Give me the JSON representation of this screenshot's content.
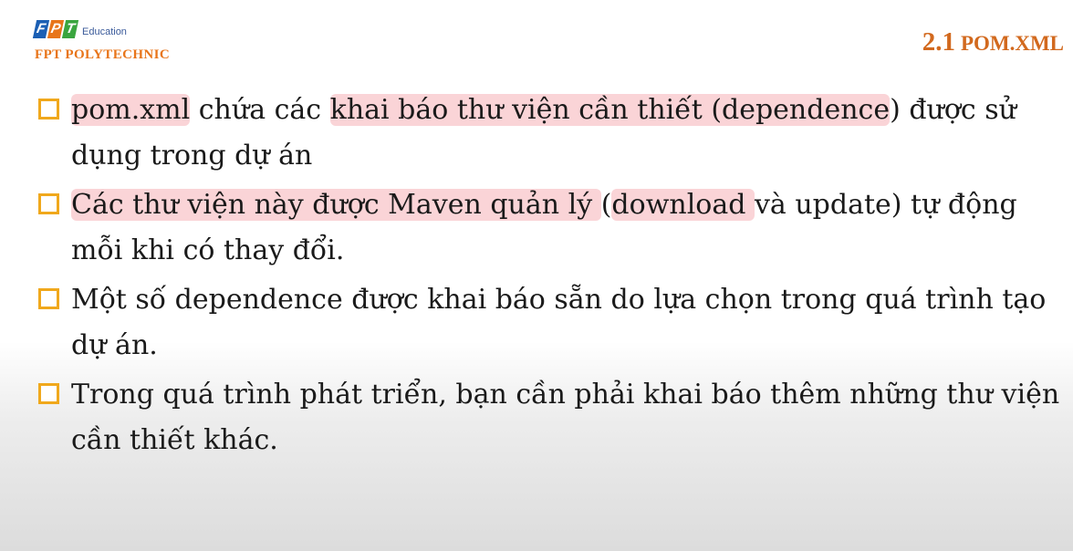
{
  "header": {
    "logo_letters": [
      "F",
      "P",
      "T"
    ],
    "logo_sub": "Education",
    "brand": "FPT POLYTECHNIC",
    "section_number": "2.1",
    "section_name": "POM.XML"
  },
  "colors": {
    "accent_orange": "#d2691e",
    "checkbox_yellow": "#f0a81c",
    "highlight_pink": "#f07882",
    "logo_blue": "#1b5fb4",
    "logo_orange": "#e8751a",
    "logo_green": "#3aa53f"
  },
  "bullets": [
    {
      "parts": [
        {
          "text": "pom.xml",
          "hl": true
        },
        {
          "text": " chứa các ",
          "hl": false
        },
        {
          "text": "khai báo thư viện cần thiết (dependence",
          "hl": true
        },
        {
          "text": ") được sử dụng trong dự án",
          "hl": false
        }
      ]
    },
    {
      "parts": [
        {
          "text": "Các thư viện này được Maven quản lý ",
          "hl": true
        },
        {
          "text": "(",
          "hl": false
        },
        {
          "text": "download ",
          "hl": true
        },
        {
          "text": "và update) tự động mỗi khi có thay đổi.",
          "hl": false
        }
      ]
    },
    {
      "parts": [
        {
          "text": "Một số dependence được khai báo sẵn do lựa chọn trong quá trình tạo dự án.",
          "hl": false
        }
      ]
    },
    {
      "parts": [
        {
          "text": "Trong quá trình phát triển, bạn cần phải khai báo thêm những thư viện cần thiết khác.",
          "hl": false
        }
      ]
    }
  ]
}
